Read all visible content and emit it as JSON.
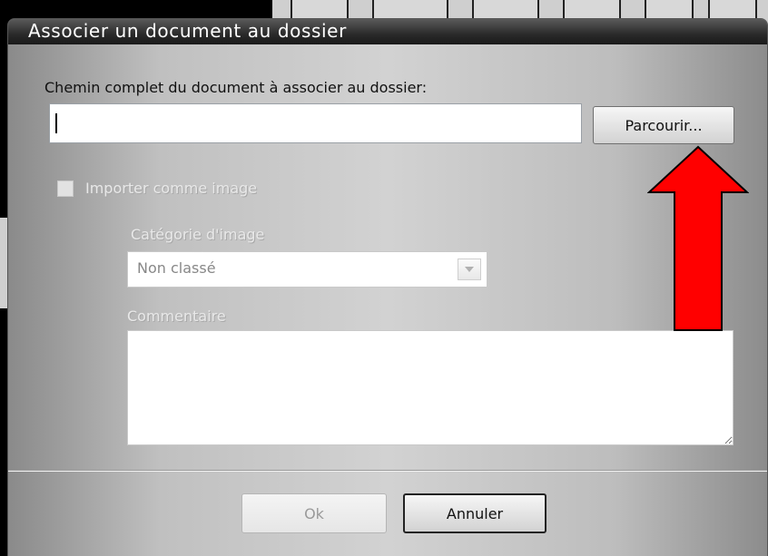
{
  "dialog": {
    "title": "Associer un document au dossier",
    "path_label": "Chemin complet du document à associer au dossier:",
    "path_value": "",
    "browse_button": "Parcourir...",
    "import_checkbox": {
      "label": "Importer comme image",
      "checked": false,
      "enabled": false
    },
    "category": {
      "label": "Catégorie d'image",
      "selected": "Non classé",
      "enabled": false
    },
    "comment": {
      "label": "Commentaire",
      "value": ""
    },
    "ok_button": "Ok",
    "cancel_button": "Annuler"
  },
  "annotation": {
    "arrow_color": "#ff0000",
    "points_to": "browse-button"
  },
  "icons": {
    "dropdown": "chevron-down-icon"
  }
}
